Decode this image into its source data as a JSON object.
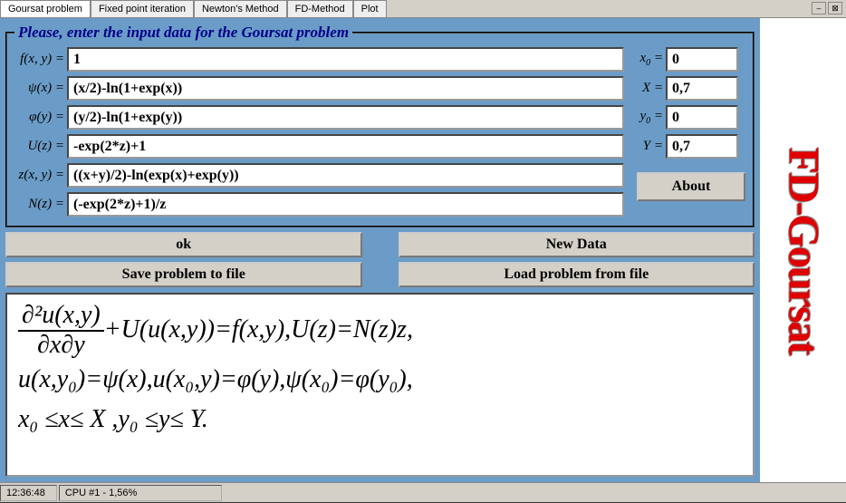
{
  "tabs": {
    "t0": "Goursat problem",
    "t1": "Fixed point iteration",
    "t2": "Newton's Method",
    "t3": "FD-Method",
    "t4": "Plot"
  },
  "legend": "Please, enter the input data for the Goursat problem",
  "fields": {
    "f_label": "f(x, y) =",
    "f_value": "1",
    "psi_label": "ψ(x) =",
    "psi_value": "(x/2)-ln(1+exp(x))",
    "phi_label": "φ(y) =",
    "phi_value": "(y/2)-ln(1+exp(y))",
    "U_label": "U(z) =",
    "U_value": "-exp(2*z)+1",
    "z_label": "z(x, y) =",
    "z_value": "((x+y)/2)-ln(exp(x)+exp(y))",
    "N_label": "N(z) =",
    "N_value": "(-exp(2*z)+1)/z"
  },
  "bounds": {
    "x0_value": "0",
    "X_value": "0,7",
    "y0_value": "0",
    "Y_value": "0,7"
  },
  "buttons": {
    "about": "About",
    "ok": "ok",
    "newdata": "New Data",
    "save": "Save problem to file",
    "load": "Load problem from file"
  },
  "side_title": "FD-Goursat",
  "status": {
    "time": "12:36:48",
    "cpu": "CPU #1  -  1,56%"
  },
  "equations": {
    "eq1_frac_num": "∂²u(x,y)",
    "eq1_frac_den": "∂x∂y",
    "eq1_rest": "+U(u(x,y))=f(x,y),U(z)=N(z)z,",
    "eq2": "u(x,y₀)=ψ(x),u(x₀,y)=φ(y),ψ(x₀)=φ(y₀),",
    "eq3": "x₀ ≤x≤ X ,y₀ ≤y≤ Y."
  }
}
